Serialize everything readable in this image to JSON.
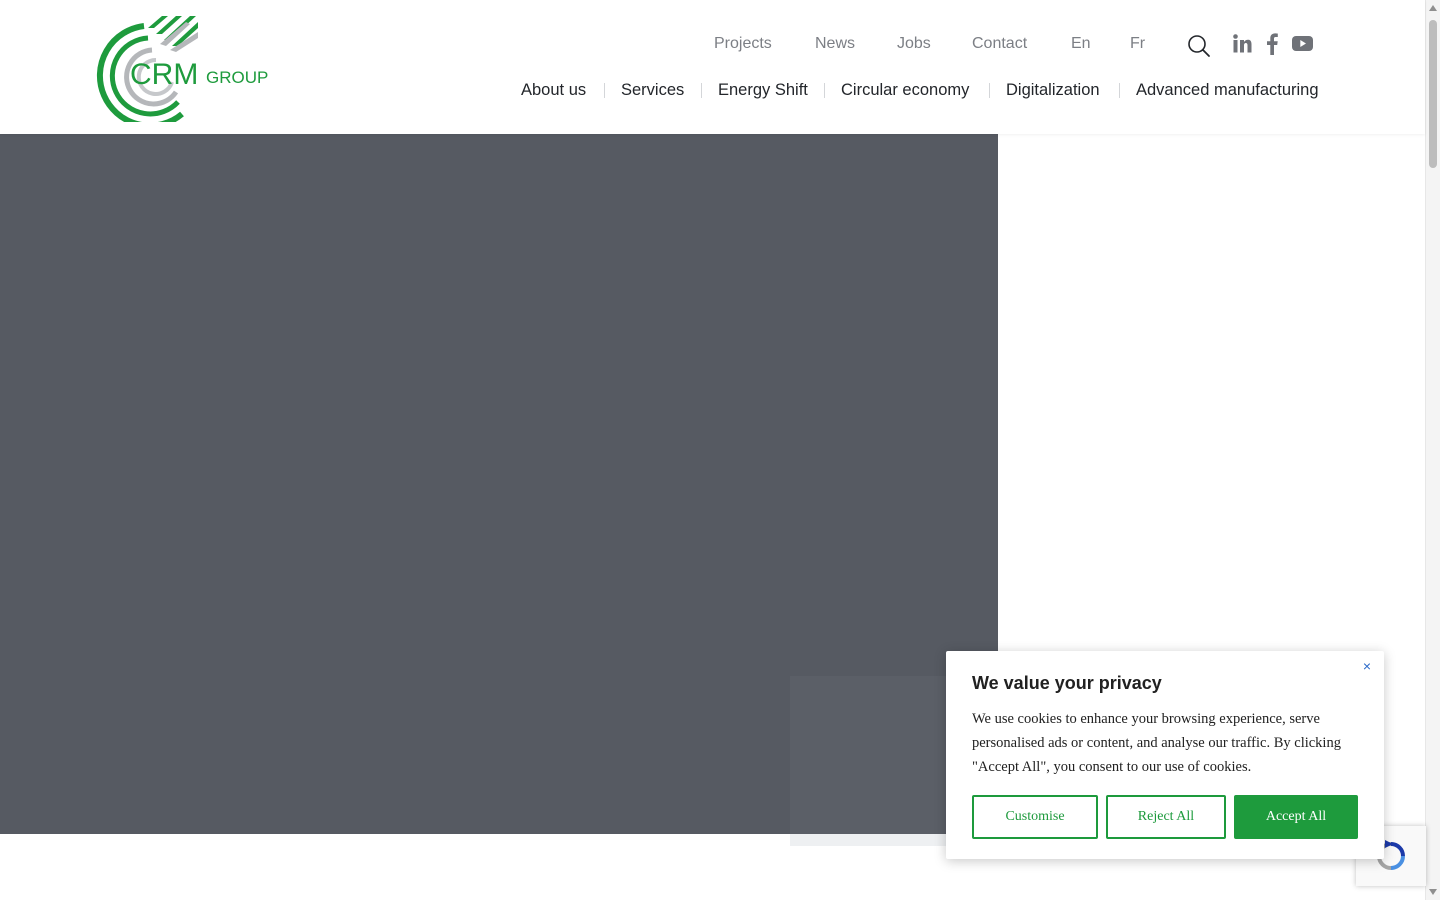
{
  "header": {
    "logo_text": "CRM",
    "logo_subtext": "GROUP",
    "top_nav": [
      "Projects",
      "News",
      "Jobs",
      "Contact",
      "En",
      "Fr"
    ],
    "main_nav": [
      "About us",
      "Services",
      "Energy Shift",
      "Circular economy",
      "Digitalization",
      "Advanced manufacturing"
    ],
    "icons": [
      "search-icon",
      "linkedin-icon",
      "facebook-icon",
      "youtube-icon"
    ]
  },
  "colors": {
    "brand_green": "#1e9b3d",
    "hero_gray": "#565a62",
    "nav_gray": "#7c7f85"
  },
  "cookie_banner": {
    "title": "We value your privacy",
    "text": "We use cookies to enhance your browsing experience, serve personalised ads or content, and analyse our traffic. By clicking \"Accept All\", you consent to our use of cookies.",
    "customise_label": "Customise",
    "reject_label": "Reject All",
    "accept_label": "Accept All",
    "close_symbol": "×"
  }
}
